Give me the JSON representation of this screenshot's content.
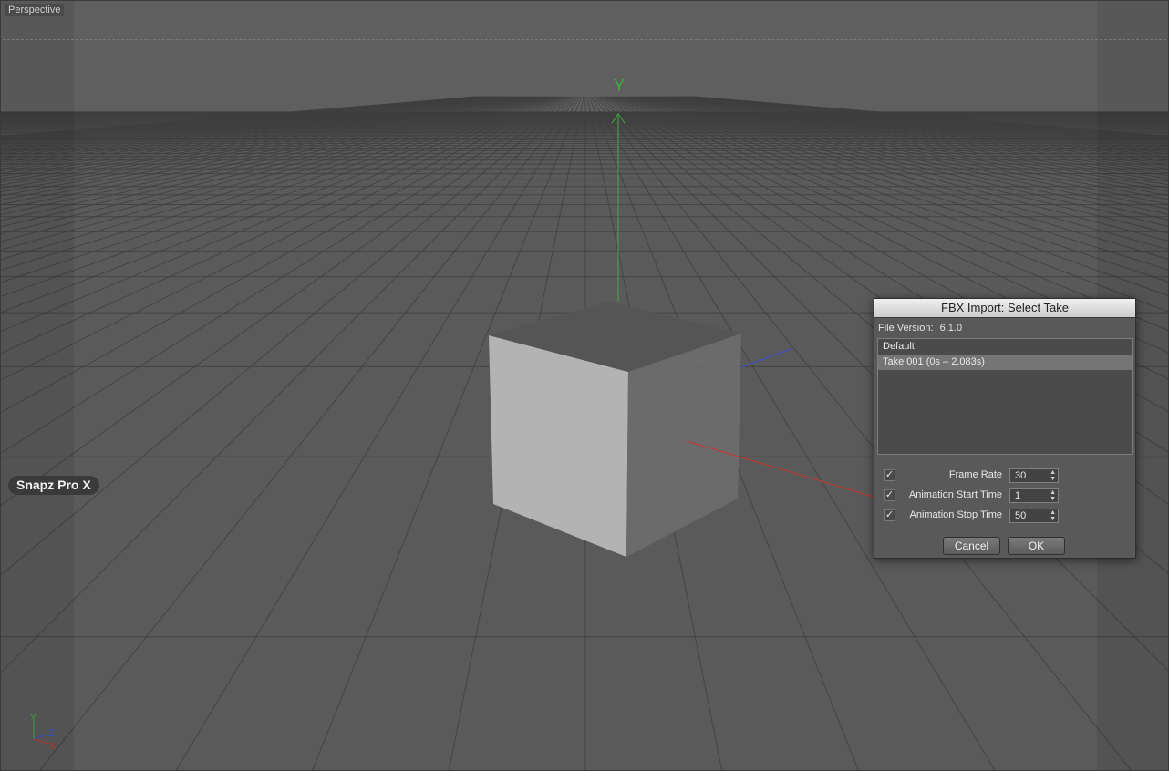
{
  "viewport": {
    "label": "Perspective",
    "axis_y_label": "Y",
    "gizmo": {
      "y": "Y",
      "z": "Z",
      "x": "X"
    }
  },
  "overlay": {
    "snapz_label": "Snapz Pro X"
  },
  "dialog": {
    "title": "FBX Import: Select Take",
    "file_version_label": "File Version:",
    "file_version_value": "6.1.0",
    "takes": [
      {
        "label": "Default",
        "selected": false
      },
      {
        "label": "Take 001 (0s – 2.083s)",
        "selected": true
      }
    ],
    "options": [
      {
        "label": "Frame Rate",
        "checked": true,
        "value": "30"
      },
      {
        "label": "Animation Start Time",
        "checked": true,
        "value": "1"
      },
      {
        "label": "Animation Stop Time",
        "checked": true,
        "value": "50"
      }
    ],
    "check_glyph": "✓",
    "spin_up": "▲",
    "spin_down": "▼",
    "cancel_label": "Cancel",
    "ok_label": "OK"
  },
  "colors": {
    "axis_x": "#c8372d",
    "axis_y": "#3fae3f",
    "axis_z": "#3a4fd0",
    "grid": "#3e3e3e",
    "cube_front": "#b3b3b3",
    "cube_top": "#555555",
    "cube_side": "#777777"
  }
}
